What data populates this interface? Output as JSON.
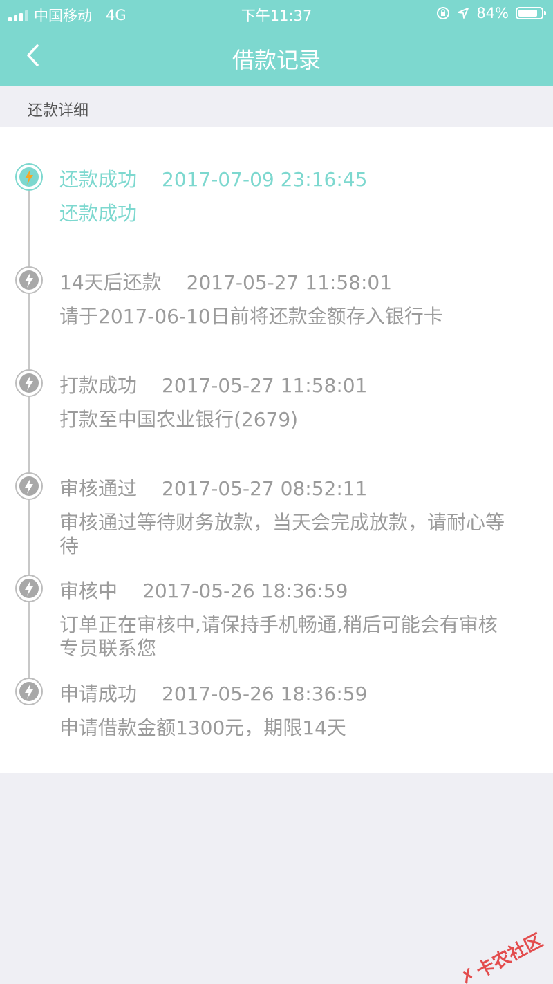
{
  "status_bar": {
    "carrier": "中国移动",
    "network": "4G",
    "time": "下午11:37",
    "battery": "84%",
    "battery_level": 0.84
  },
  "nav": {
    "title": "借款记录",
    "back_icon": "chevron-left-icon"
  },
  "section": {
    "title": "还款详细"
  },
  "timeline": [
    {
      "status": "还款成功",
      "datetime": "2017-07-09 23:16:45",
      "desc": "还款成功",
      "active": true
    },
    {
      "status": "14天后还款",
      "datetime": "2017-05-27 11:58:01",
      "desc": "请于2017-06-10日前将还款金额存入银行卡",
      "active": false
    },
    {
      "status": "打款成功",
      "datetime": "2017-05-27 11:58:01",
      "desc": "打款至中国农业银行(2679)",
      "active": false
    },
    {
      "status": "审核通过",
      "datetime": "2017-05-27 08:52:11",
      "desc": "审核通过等待财务放款，当天会完成放款，请耐心等待",
      "active": false
    },
    {
      "status": "审核中",
      "datetime": "2017-05-26 18:36:59",
      "desc": "订单正在审核中,请保持手机畅通,稍后可能会有审核专员联系您",
      "active": false
    },
    {
      "status": "申请成功",
      "datetime": "2017-05-26 18:36:59",
      "desc": "申请借款金额1300元，期限14天",
      "active": false
    }
  ],
  "watermark": "卡农社区",
  "colors": {
    "accent": "#7dd8cf",
    "active_icon": "#f5a623",
    "inactive": "#9b9b9b"
  }
}
